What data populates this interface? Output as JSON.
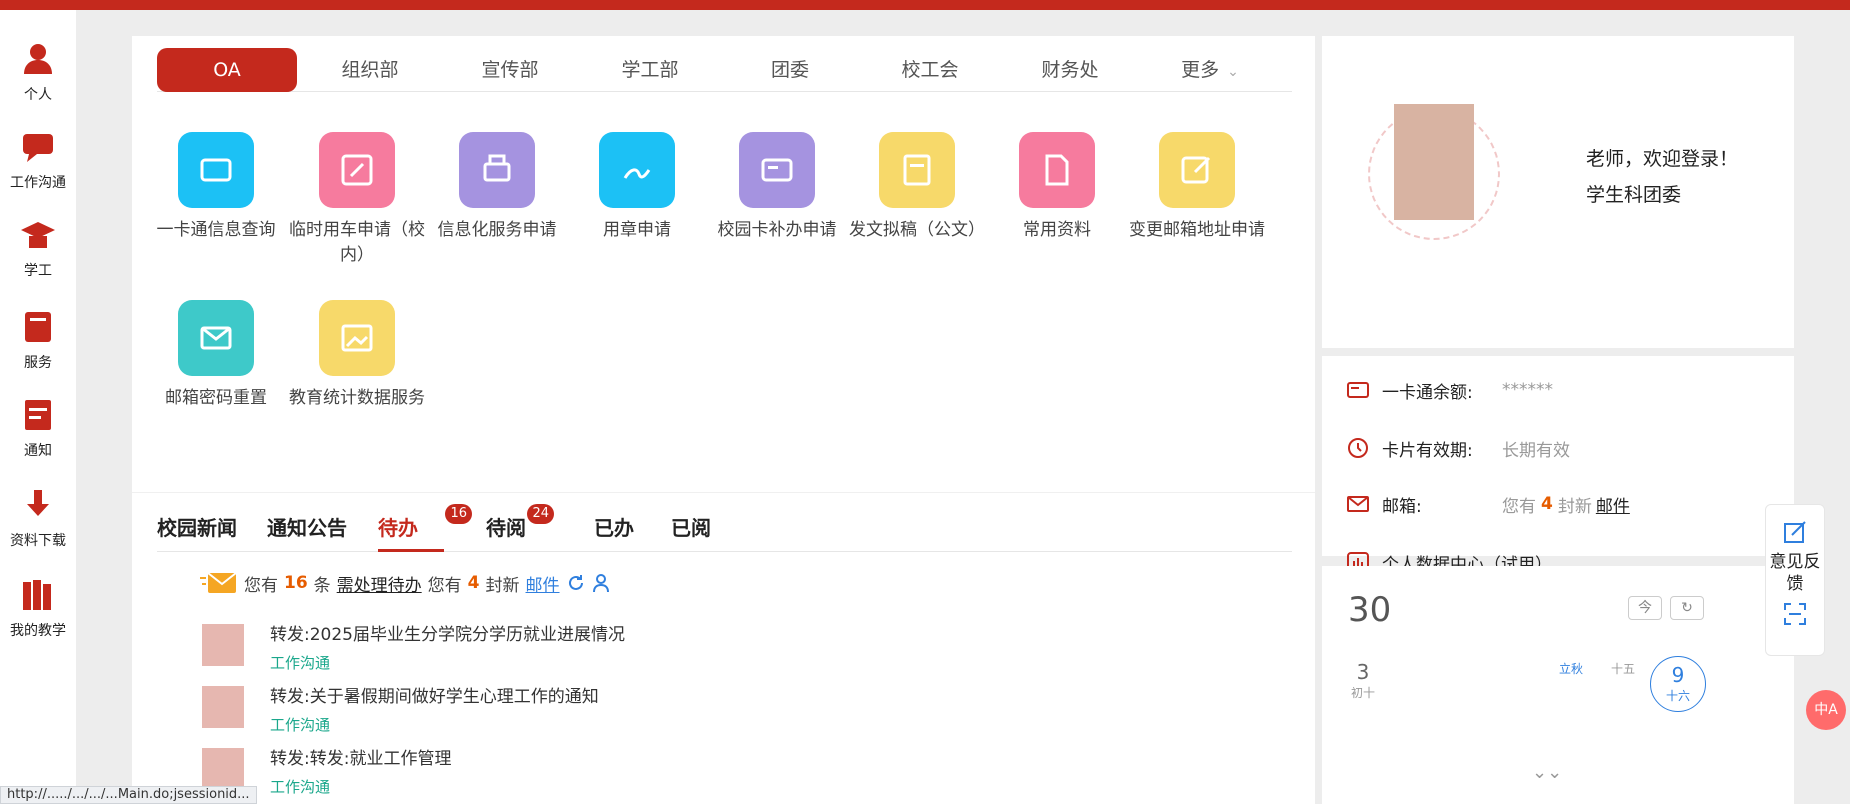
{
  "nav": {
    "items": [
      {
        "label": "个人"
      },
      {
        "label": "工作沟通"
      },
      {
        "label": "学工"
      },
      {
        "label": "服务"
      },
      {
        "label": "通知"
      },
      {
        "label": "资料下载"
      },
      {
        "label": "我的教学"
      }
    ]
  },
  "tabs": [
    "OA",
    "组织部",
    "宣传部",
    "学工部",
    "团委",
    "校工会",
    "财务处",
    "更多"
  ],
  "apps": [
    {
      "label": "一卡通信息查询",
      "color": "#1cc1f5"
    },
    {
      "label": "临时用车申请（校内）",
      "color": "#f67b9e"
    },
    {
      "label": "信息化服务申请",
      "color": "#a593e0"
    },
    {
      "label": "用章申请",
      "color": "#1cc1f5"
    },
    {
      "label": "校园卡补办申请",
      "color": "#a593e0"
    },
    {
      "label": "发文拟稿（公文）",
      "color": "#f7d96a"
    },
    {
      "label": "常用资料",
      "color": "#f67b9e"
    },
    {
      "label": "变更邮箱地址申请",
      "color": "#f7d96a"
    },
    {
      "label": "邮箱密码重置",
      "color": "#3ec9c9"
    },
    {
      "label": "教育统计数据服务",
      "color": "#f7d96a"
    }
  ],
  "news_tabs": [
    {
      "label": "校园新闻"
    },
    {
      "label": "通知公告"
    },
    {
      "label": "待办",
      "badge": "16"
    },
    {
      "label": "待阅",
      "badge": "24"
    },
    {
      "label": "已办"
    },
    {
      "label": "已阅"
    }
  ],
  "summary": {
    "prefix": "您有",
    "todo_count": "16",
    "todo_unit": "条",
    "todo_link": "需处理待办",
    "mail_prefix": "您有",
    "mail_count": "4",
    "mail_unit": "封新",
    "mail_link": "邮件"
  },
  "messages": [
    {
      "title": "转发:2025届毕业生分学院分学历就业进展情况",
      "meta": "工作沟通"
    },
    {
      "title": "转发:关于暑假期间做好学生心理工作的通知",
      "meta": "工作沟通"
    },
    {
      "title": "转发:转发:就业工作管理",
      "meta": "工作沟通"
    }
  ],
  "user": {
    "welcome": "老师，欢迎登录！",
    "dept": "学生科团委"
  },
  "info": {
    "card_label": "一卡通余额:",
    "card_value": "******",
    "valid_label": "卡片有效期:",
    "valid_value": "长期有效",
    "mail_label": "邮箱:",
    "mail_prefix": "您有",
    "mail_count": "4",
    "mail_unit": "封新",
    "mail_link": "邮件",
    "data_center": "个人数据中心（试用）"
  },
  "calendar": {
    "day": "30",
    "today_btn": "今",
    "refresh_btn": "↻",
    "cells": [
      {
        "num": "3",
        "sub": "初十"
      },
      {
        "num": "",
        "sub": ""
      },
      {
        "num": "",
        "sub": ""
      },
      {
        "num": "",
        "sub": ""
      },
      {
        "num": "",
        "sub": "立秋"
      },
      {
        "num": "",
        "sub": "十五"
      },
      {
        "num": "9",
        "sub": "十六"
      }
    ],
    "expand": "⌄⌄"
  },
  "feedback": {
    "label": "意见反馈"
  },
  "ime": {
    "label": "中A"
  },
  "status_url": "http://...../.../.../...Main.do;jsessionid..."
}
